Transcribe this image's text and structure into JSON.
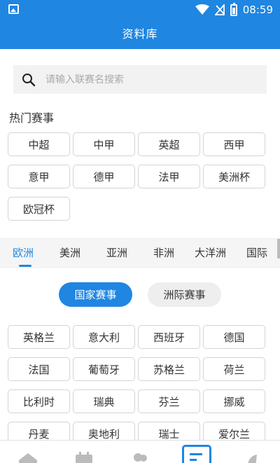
{
  "status_bar": {
    "time": "08:59"
  },
  "app_bar": {
    "title": "资料库"
  },
  "search": {
    "placeholder": "请输入联赛名搜索"
  },
  "hot": {
    "title": "热门赛事",
    "items": [
      "中超",
      "中甲",
      "英超",
      "西甲",
      "意甲",
      "德甲",
      "法甲",
      "美洲杯",
      "欧冠杯"
    ]
  },
  "regions": {
    "tabs": [
      "欧洲",
      "美洲",
      "亚洲",
      "非洲",
      "大洋洲",
      "国际"
    ],
    "active": "欧洲"
  },
  "toggle": {
    "national": "国家赛事",
    "intercontinental": "洲际赛事"
  },
  "countries": [
    "英格兰",
    "意大利",
    "西班牙",
    "德国",
    "法国",
    "葡萄牙",
    "苏格兰",
    "荷兰",
    "比利时",
    "瑞典",
    "芬兰",
    "挪威",
    "丹麦",
    "奥地利",
    "瑞士",
    "爱尔兰"
  ],
  "colors": {
    "primary": "#1f86e2",
    "tab_bar_bg": "#f5f5f5",
    "search_bg": "#f2f2f2"
  },
  "bottom_nav": {
    "icons": [
      "home-icon",
      "calendar-icon",
      "people-icon",
      "database-icon",
      "profile-icon"
    ],
    "active": "database-icon"
  }
}
